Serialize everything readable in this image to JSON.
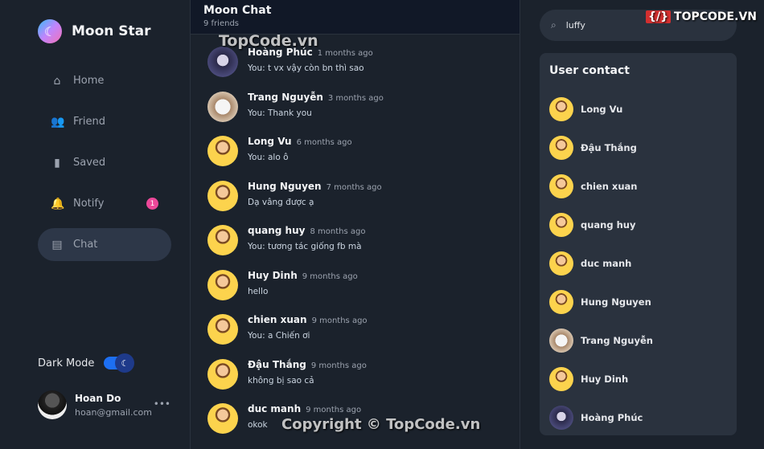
{
  "sidebar": {
    "app_name": "Moon Star",
    "nav": [
      {
        "label": "Home",
        "icon": "home-icon",
        "glyph": "⌂"
      },
      {
        "label": "Friend",
        "icon": "people-icon",
        "glyph": "👥"
      },
      {
        "label": "Saved",
        "icon": "bookmark-icon",
        "glyph": "▮"
      },
      {
        "label": "Notify",
        "icon": "bell-icon",
        "glyph": "🔔",
        "badge": "1"
      },
      {
        "label": "Chat",
        "icon": "chat-icon",
        "glyph": "▤",
        "active": true
      }
    ],
    "dark_mode_label": "Dark Mode",
    "dark_mode_on": true,
    "user": {
      "name": "Hoan Do",
      "email": "hoan@gmail.com"
    }
  },
  "chat": {
    "title": "Moon Chat",
    "subtitle": "9 friends",
    "conversations": [
      {
        "name": "Hoàng Phúc",
        "time": "1 months ago",
        "message": "You: t vx vậy còn bn thì sao",
        "avatar": "anime"
      },
      {
        "name": "Trang Nguyễn",
        "time": "3 months ago",
        "message": "You: Thank you",
        "avatar": "cat"
      },
      {
        "name": "Long Vu",
        "time": "6 months ago",
        "message": "You: alo ô",
        "avatar": "default"
      },
      {
        "name": "Hung Nguyen",
        "time": "7 months ago",
        "message": "Dạ vâng được ạ",
        "avatar": "default"
      },
      {
        "name": "quang huy",
        "time": "8 months ago",
        "message": "You: tương tác giống fb mà",
        "avatar": "default"
      },
      {
        "name": "Huy Dinh",
        "time": "9 months ago",
        "message": "hello",
        "avatar": "default"
      },
      {
        "name": "chien xuan",
        "time": "9 months ago",
        "message": "You: a Chiến ơi",
        "avatar": "default"
      },
      {
        "name": "Đậu Thắng",
        "time": "9 months ago",
        "message": "không bị sao cả",
        "avatar": "default"
      },
      {
        "name": "duc manh",
        "time": "9 months ago",
        "message": "okok",
        "avatar": "default"
      }
    ]
  },
  "search": {
    "value": "luffy"
  },
  "contacts": {
    "title": "User contact",
    "items": [
      {
        "name": "Long Vu",
        "avatar": "default"
      },
      {
        "name": "Đậu Thắng",
        "avatar": "default"
      },
      {
        "name": "chien xuan",
        "avatar": "default"
      },
      {
        "name": "quang huy",
        "avatar": "default"
      },
      {
        "name": "duc manh",
        "avatar": "default"
      },
      {
        "name": "Hung Nguyen",
        "avatar": "default"
      },
      {
        "name": "Trang Nguyễn",
        "avatar": "cat"
      },
      {
        "name": "Huy Dinh",
        "avatar": "default"
      },
      {
        "name": "Hoàng Phúc",
        "avatar": "anime"
      }
    ]
  },
  "watermarks": {
    "top": "TopCode.vn",
    "bottom": "Copyright © TopCode.vn",
    "brand": "TOPCODE.VN"
  }
}
